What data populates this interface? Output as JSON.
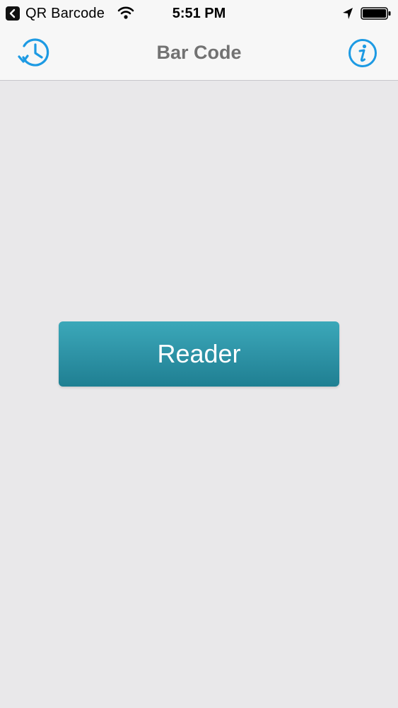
{
  "status_bar": {
    "back_app_label": "QR Barcode",
    "time": "5:51 PM"
  },
  "nav_bar": {
    "title": "Bar Code",
    "left_icon": "history-icon",
    "right_icon": "info-icon"
  },
  "main": {
    "reader_button_label": "Reader"
  },
  "colors": {
    "accent_blue": "#1d9ae3",
    "button_teal": "#2e93a6",
    "title_gray": "#727272",
    "background": "#e9e8ea"
  }
}
